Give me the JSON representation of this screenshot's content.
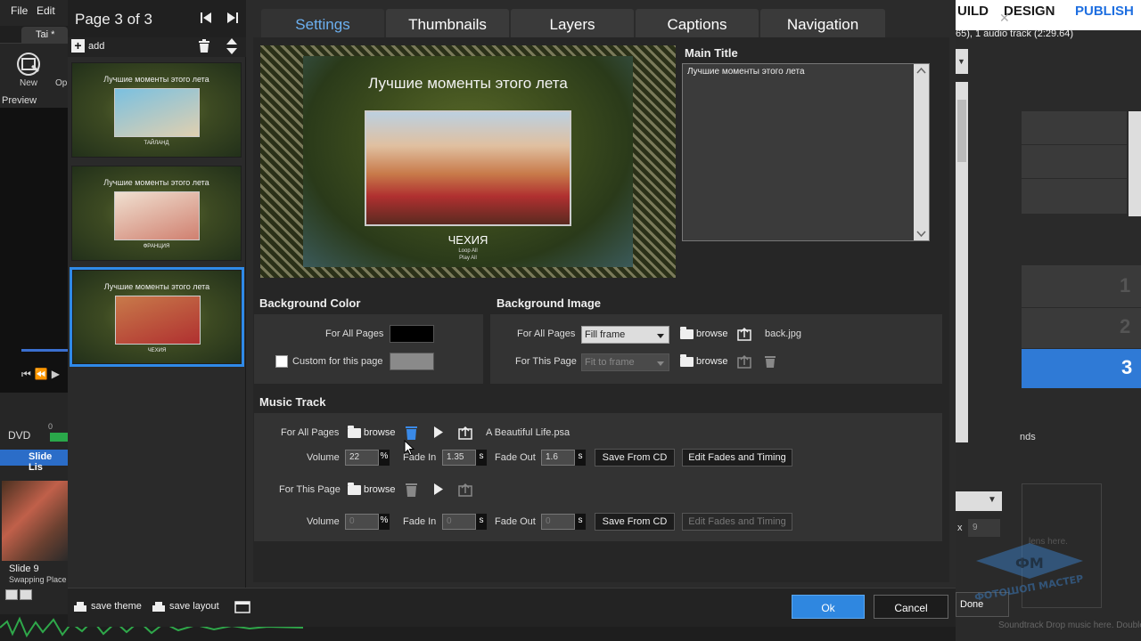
{
  "app": {
    "menu": [
      "File",
      "Edit"
    ],
    "doc_tab": "Tai *",
    "tools": {
      "new_label": "New",
      "open_label": "Op"
    },
    "preview_label": "Preview",
    "dvd_label": "DVD",
    "dvd_meter_value": "0",
    "slide_list_tab": "Slide Lis",
    "slide": {
      "label": "Slide 9",
      "sub": "Swapping Place"
    },
    "header_nav": {
      "build": "UILD",
      "design": "DESIGN",
      "publish": "PUBLISH"
    },
    "info_text": "65), 1 audio track (2:29.64)",
    "selected_page_num": "3",
    "row_nums": [
      "1",
      "2"
    ],
    "sounds_label": "nds",
    "size_value": "9",
    "size_x": "x",
    "drop_text": "lens here.",
    "done_label": "Done",
    "bottom_hint": "Soundtrack  Drop music here.  Double click to",
    "watermark_text": "ФОТОШОП МАСТЕР",
    "accent_color": "#2f87e0"
  },
  "dialog": {
    "page_title": "Page 3 of 3",
    "add_label": "add",
    "thumbs": [
      {
        "title": "Лучшие моменты этого лета",
        "caption": "ТАЙЛАНД",
        "photo_colors": [
          "#7ac0e0",
          "#e0d0b0"
        ]
      },
      {
        "title": "Лучшие моменты этого лета",
        "caption": "ФРАНЦИЯ",
        "photo_colors": [
          "#f0e0d0",
          "#d08070"
        ]
      },
      {
        "title": "Лучшие моменты этого лета",
        "caption": "ЧЕХИЯ",
        "photo_colors": [
          "#c87a4a",
          "#b03030"
        ]
      }
    ],
    "tabs": [
      "Settings",
      "Thumbnails",
      "Layers",
      "Captions",
      "Navigation"
    ],
    "active_tab": "Settings",
    "preview": {
      "title": "Лучшие моменты этого лета",
      "caption": "ЧЕХИЯ",
      "loop_all": "Loop All",
      "play_all": "Play All"
    },
    "main_title": {
      "label": "Main Title",
      "value": "Лучшие моменты этого лета"
    },
    "background_color": {
      "label": "Background Color",
      "for_all_pages": "For All Pages",
      "custom_label": "Custom for this page",
      "all_color": "#000000",
      "custom_color": "#8a8a8a"
    },
    "background_image": {
      "label": "Background Image",
      "for_all_pages": "For All Pages",
      "for_this_page": "For This Page",
      "all_mode": "Fill frame",
      "page_mode": "Fit to frame",
      "browse": "browse",
      "file": "back.jpg"
    },
    "music": {
      "label": "Music Track",
      "all": {
        "label": "For All Pages",
        "browse": "browse",
        "file": "A Beautiful Life.psa",
        "volume_label": "Volume",
        "volume": "22",
        "volume_unit": "%",
        "fade_in_label": "Fade In",
        "fade_in": "1.35",
        "fade_in_unit": "s",
        "fade_out_label": "Fade Out",
        "fade_out": "1.6",
        "fade_out_unit": "s",
        "save_cd": "Save From CD",
        "edit_fades": "Edit Fades and Timing"
      },
      "page": {
        "label": "For This Page",
        "browse": "browse",
        "volume_label": "Volume",
        "volume": "0",
        "volume_unit": "%",
        "fade_in_label": "Fade In",
        "fade_in": "0",
        "fade_in_unit": "s",
        "fade_out_label": "Fade Out",
        "fade_out": "0",
        "fade_out_unit": "s",
        "save_cd": "Save From CD",
        "edit_fades": "Edit Fades and Timing"
      }
    },
    "bottom": {
      "save_theme": "save theme",
      "save_layout": "save layout",
      "ok": "Ok",
      "cancel": "Cancel"
    }
  }
}
